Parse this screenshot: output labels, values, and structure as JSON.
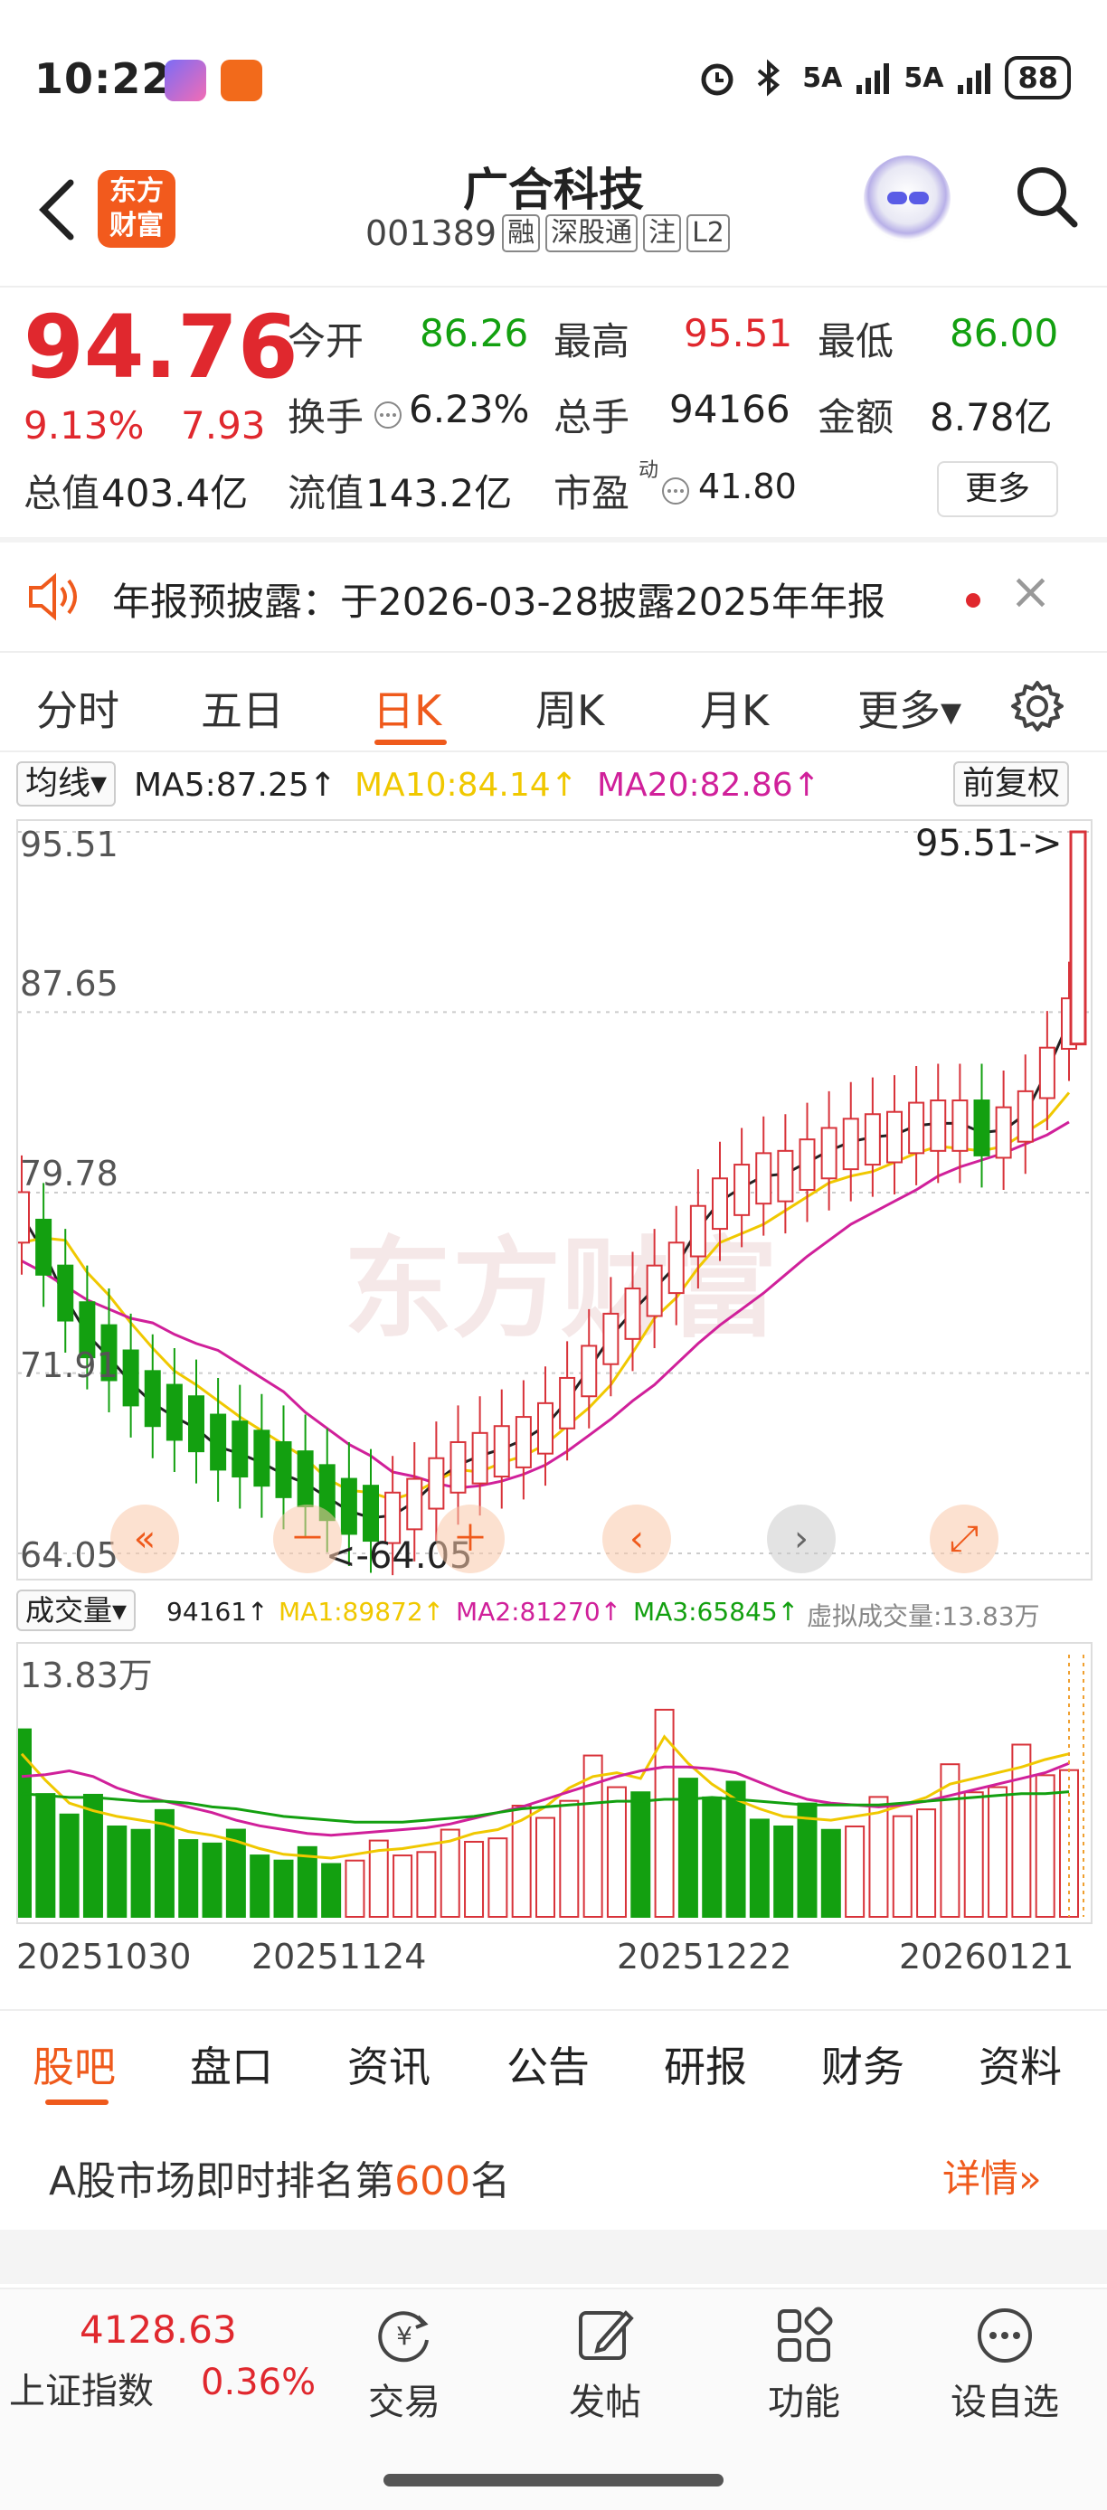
{
  "status_bar": {
    "time": "10:22",
    "signal1": "5A",
    "signal2": "5A",
    "battery": "88"
  },
  "header": {
    "logo_text": "东方财富",
    "stock_name": "广合科技",
    "stock_code": "001389",
    "tags": [
      "融",
      "深股通",
      "注",
      "L2"
    ]
  },
  "quote": {
    "price": "94.76",
    "change_pct": "9.13%",
    "change_amt": "7.93",
    "open_label": "今开",
    "open": "86.26",
    "high_label": "最高",
    "high": "95.51",
    "low_label": "最低",
    "low": "86.00",
    "turnover_label": "换手",
    "turnover": "6.23%",
    "volume_label": "总手",
    "volume": "94166",
    "amount_label": "金额",
    "amount": "8.78亿",
    "mktcap_label": "总值",
    "mktcap": "403.4亿",
    "float_label": "流值",
    "float": "143.2亿",
    "pe_label": "市盈",
    "pe_sup": "动",
    "pe": "41.80",
    "more_label": "更多"
  },
  "notice": {
    "text": "年报预披露：于2026-03-28披露2025年年报",
    "close": "×"
  },
  "period_tabs": [
    "分时",
    "五日",
    "日K",
    "周K",
    "月K",
    "更多▾"
  ],
  "active_period": "日K",
  "ma_legend": {
    "selector": "均线▾",
    "ma5": "MA5:87.25↑",
    "ma10": "MA10:84.14↑",
    "ma20": "MA20:82.86↑",
    "adjust": "前复权",
    "ma5_color": "#222222",
    "ma10_color": "#f0c800",
    "ma20_color": "#d0209a"
  },
  "chart_data": [
    {
      "type": "candlestick",
      "title": "",
      "y_ticks": [
        "95.51",
        "87.65",
        "79.78",
        "71.91",
        "64.05"
      ],
      "ylim": [
        64.05,
        95.51
      ],
      "max_label": "95.51->",
      "min_label": "<-64.05",
      "up_color": "#d8333a",
      "down_color": "#13a010",
      "series": [
        {
          "name": "MA5",
          "values": [
            78.8,
            77.2,
            75.2,
            73.6,
            72.6,
            71.5,
            70.6,
            70.0,
            69.5,
            68.7,
            68.4,
            68.0,
            67.5,
            67.1,
            66.5,
            65.9,
            65.6,
            65.7,
            66.3,
            67.2,
            67.9,
            68.3,
            68.6,
            69.0,
            69.6,
            70.7,
            72.1,
            73.5,
            74.6,
            75.6,
            76.6,
            78.2,
            79.4,
            80.0,
            80.5,
            80.6,
            81.1,
            81.6,
            82.0,
            82.2,
            82.3,
            82.7,
            82.8,
            82.8,
            82.4,
            82.5,
            83.2,
            85.1,
            87.25
          ]
        },
        {
          "name": "MA10",
          "values": [
            77.6,
            77.8,
            77.7,
            76.3,
            75.3,
            74.1,
            73.0,
            72.0,
            71.4,
            70.7,
            70.0,
            69.4,
            68.8,
            68.2,
            67.3,
            66.8,
            66.7,
            66.4,
            66.7,
            67.2,
            67.7,
            67.6,
            68.0,
            68.3,
            68.8,
            69.6,
            70.4,
            71.4,
            72.8,
            74.3,
            75.2,
            76.5,
            77.6,
            78.0,
            78.4,
            79.0,
            79.6,
            80.2,
            80.5,
            80.7,
            81.1,
            81.5,
            81.8,
            81.7,
            81.6,
            81.8,
            82.4,
            83.0,
            84.14
          ]
        },
        {
          "name": "MA20",
          "values": [
            76.8,
            76.3,
            75.7,
            75.1,
            74.7,
            74.3,
            74.1,
            73.6,
            73.2,
            72.9,
            72.3,
            71.7,
            71.1,
            70.2,
            69.5,
            68.8,
            68.3,
            67.6,
            67.4,
            67.1,
            66.9,
            67.0,
            67.2,
            67.5,
            67.9,
            68.5,
            69.2,
            69.9,
            70.7,
            71.4,
            72.3,
            73.2,
            74.0,
            74.7,
            75.4,
            76.2,
            77.0,
            77.7,
            78.4,
            78.9,
            79.4,
            79.9,
            80.5,
            80.9,
            81.2,
            81.5,
            81.9,
            82.3,
            82.86
          ]
        }
      ]
    },
    {
      "type": "bar",
      "title": "成交量",
      "y_ticks": [
        "13.83万"
      ],
      "ylim": [
        0,
        13.83
      ],
      "x_tick_labels": [
        "20251030",
        "20251124",
        "20251222",
        "20260121"
      ],
      "series": [
        {
          "name": "MA1",
          "values": [
            8.6,
            7.2,
            6.0,
            5.6,
            5.3,
            5.1,
            4.9,
            4.5,
            4.3,
            4.0,
            3.6,
            3.3,
            3.2,
            3.1,
            3.3,
            3.5,
            3.6,
            3.8,
            4.0,
            4.4,
            4.6,
            5.1,
            5.8,
            6.8,
            7.4,
            7.6,
            7.3,
            9.5,
            8.1,
            7.0,
            6.2,
            5.7,
            5.3,
            5.2,
            5.1,
            5.3,
            5.5,
            5.9,
            6.3,
            7.0,
            7.3,
            7.6,
            7.9,
            8.3,
            8.6
          ]
        },
        {
          "name": "MA2",
          "values": [
            7.4,
            7.5,
            7.7,
            7.4,
            6.8,
            6.4,
            6.1,
            5.8,
            5.5,
            5.1,
            4.8,
            4.6,
            4.4,
            4.3,
            4.4,
            4.5,
            4.6,
            4.7,
            4.9,
            5.2,
            5.5,
            5.8,
            6.2,
            6.6,
            7.0,
            7.4,
            7.7,
            7.9,
            7.9,
            7.8,
            7.6,
            7.1,
            6.6,
            6.2,
            6.0,
            5.9,
            5.8,
            5.9,
            6.1,
            6.4,
            6.7,
            7.0,
            7.3,
            7.6,
            8.1
          ]
        },
        {
          "name": "MA3",
          "values": [
            6.5,
            6.4,
            6.3,
            6.3,
            6.2,
            6.1,
            6.1,
            6.0,
            5.8,
            5.7,
            5.5,
            5.3,
            5.2,
            5.1,
            5.0,
            5.0,
            5.0,
            5.1,
            5.2,
            5.3,
            5.5,
            5.7,
            5.8,
            5.9,
            6.0,
            6.1,
            6.1,
            6.2,
            6.2,
            6.3,
            6.2,
            6.1,
            6.0,
            5.9,
            5.9,
            5.9,
            5.9,
            6.0,
            6.1,
            6.2,
            6.3,
            6.4,
            6.5,
            6.5,
            6.6
          ]
        }
      ]
    }
  ],
  "volume_legend": {
    "selector": "成交量▾",
    "vol": "94161↑",
    "ma1": "MA1:89872↑",
    "ma2": "MA2:81270↑",
    "ma3": "MA3:65845↑",
    "virtual": "虚拟成交量:13.83万"
  },
  "bottom_tabs": [
    "股吧",
    "盘口",
    "资讯",
    "公告",
    "研报",
    "财务",
    "资料"
  ],
  "rank": {
    "prefix": "A股市场即时排名第",
    "number": "600",
    "suffix": "名",
    "detail": "详情»"
  },
  "index_box": {
    "value": "4128.63",
    "name": "上证指数",
    "pct": "0.36%"
  },
  "nav": [
    "交易",
    "发帖",
    "功能",
    "设自选"
  ],
  "watermark": "东方财富"
}
